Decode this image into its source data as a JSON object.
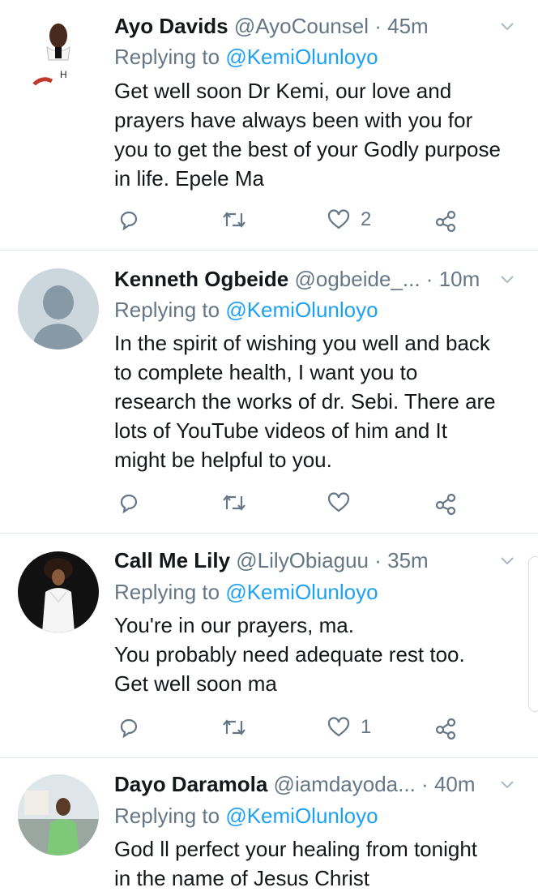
{
  "tweets": [
    {
      "name": "Ayo Davids",
      "handle": "@AyoCounsel",
      "time": "45m",
      "replying_prefix": "Replying to",
      "replying_to": "@KemiOlunloyo",
      "lines": [
        "Get well soon Dr Kemi, our love and",
        "prayers have always been with you for",
        "you to get the best of your Godly purpose",
        "in life. Epele Ma"
      ],
      "like_count": "2"
    },
    {
      "name": "Kenneth Ogbeide",
      "handle": "@ogbeide_...",
      "time": "10m",
      "replying_prefix": "Replying to",
      "replying_to": "@KemiOlunloyo",
      "lines": [
        "In the spirit of wishing you well and back",
        "to complete health, I want you to",
        "research the works of dr. Sebi. There are",
        "lots of YouTube videos of him and It",
        "might be helpful to you."
      ],
      "like_count": ""
    },
    {
      "name": "Call Me Lily",
      "handle": "@LilyObiaguu",
      "time": "35m",
      "replying_prefix": "Replying to",
      "replying_to": "@KemiOlunloyo",
      "lines": [
        "You're in our prayers, ma.",
        "You probably need adequate rest too.",
        "Get well soon ma"
      ],
      "like_count": "1"
    },
    {
      "name": "Dayo Daramola",
      "handle": "@iamdayoda...",
      "time": "40m",
      "replying_prefix": "Replying to",
      "replying_to": "@KemiOlunloyo",
      "lines": [
        "God ll perfect your healing from tonight",
        "in the name of Jesus Christ"
      ],
      "like_count": ""
    }
  ],
  "colors": {
    "accent": "#1da1f2",
    "muted": "#657786",
    "text": "#14171a",
    "divider": "#e1e8ed"
  },
  "icons": [
    "reply-icon",
    "retweet-icon",
    "like-icon",
    "share-icon",
    "chevron-down-icon"
  ]
}
